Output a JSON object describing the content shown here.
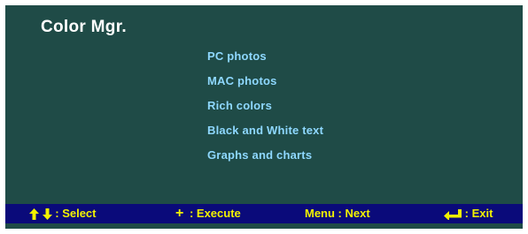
{
  "osd": {
    "title": "Color Mgr.",
    "menu_items": [
      "PC photos",
      "MAC photos",
      "Rich colors",
      "Black and White text",
      "Graphs and charts"
    ]
  },
  "status_bar": {
    "select_label": ": Select",
    "select_icons": [
      "up-arrow-icon",
      "down-arrow-icon"
    ],
    "execute_label": ": Execute",
    "execute_symbol": "+",
    "next_label": "Menu : Next",
    "exit_label": ": Exit",
    "exit_icon": "enter-return-icon"
  },
  "colors": {
    "panel_background": "#1f4b47",
    "title_text": "#ffffff",
    "menu_text": "#8ed8ff",
    "status_bar_background": "#0a0a7a",
    "status_bar_text": "#f2f200"
  }
}
